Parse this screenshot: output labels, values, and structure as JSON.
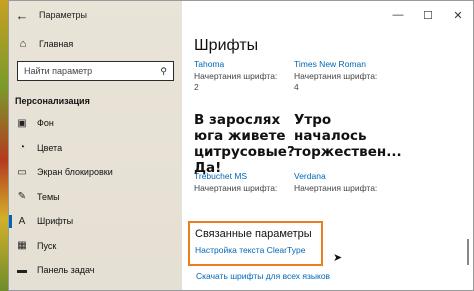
{
  "window": {
    "title": "Параметры",
    "minimize": "—",
    "maximize": "☐",
    "close": "✕",
    "back_glyph": "←"
  },
  "sidebar": {
    "home": {
      "label": "Главная",
      "icon": "home-icon",
      "glyph": "⌂"
    },
    "search": {
      "placeholder": "Найти параметр",
      "glyph": "⚲"
    },
    "section_title": "Персонализация",
    "items": [
      {
        "label": "Фон",
        "icon": "picture-icon",
        "glyph": "▣",
        "active": false
      },
      {
        "label": "Цвета",
        "icon": "palette-icon",
        "glyph": "◔",
        "active": false
      },
      {
        "label": "Экран блокировки",
        "icon": "lock-screen-icon",
        "glyph": "▭",
        "active": false
      },
      {
        "label": "Темы",
        "icon": "brush-icon",
        "glyph": "✎",
        "active": false
      },
      {
        "label": "Шрифты",
        "icon": "fonts-icon",
        "glyph": "A",
        "active": true
      },
      {
        "label": "Пуск",
        "icon": "start-icon",
        "glyph": "▦",
        "active": false
      },
      {
        "label": "Панель задач",
        "icon": "taskbar-icon",
        "glyph": "▬",
        "active": false
      }
    ]
  },
  "main": {
    "title": "Шрифты",
    "tiles_top": [
      {
        "name": "Tahoma",
        "faces_label": "Начертания шрифта:",
        "count": "2"
      },
      {
        "name": "Times New Roman",
        "faces_label": "Начертания шрифта:",
        "count": "4"
      }
    ],
    "tiles_bottom": [
      {
        "sample": "В зарослях юга живете цитрусовые? Да!",
        "name": "Trebuchet MS",
        "faces_label": "Начертания шрифта:",
        "count": ""
      },
      {
        "sample": "Утро началось торжествен...",
        "name": "Verdana",
        "faces_label": "Начертания шрифта:",
        "count": ""
      }
    ],
    "related": {
      "title": "Связанные параметры",
      "link": "Настройка текста ClearType"
    },
    "more_link": "Скачать шрифты для всех языков"
  },
  "colors": {
    "accent": "#0067b8",
    "highlight_border": "#e8801f"
  }
}
